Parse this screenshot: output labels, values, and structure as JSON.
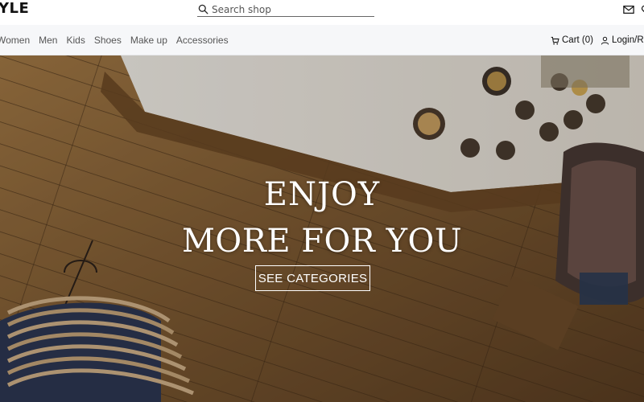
{
  "header": {
    "brand": "YLE",
    "search_placeholder": "Search shop",
    "icons": [
      "envelope-icon",
      "heart-icon"
    ]
  },
  "nav": {
    "items": [
      "Women",
      "Men",
      "Kids",
      "Shoes",
      "Make up",
      "Accessories"
    ],
    "cart_label": "Cart (0)",
    "login_label": "Login/Re"
  },
  "hero": {
    "title_line1": "ENJOY",
    "title_line2": "MORE FOR YOU",
    "cta_label": "SEE CATEGORIES"
  },
  "colors": {
    "nav_bg": "#f6f7f9",
    "floor": "#8a6437",
    "counter": "#ece6dc"
  }
}
